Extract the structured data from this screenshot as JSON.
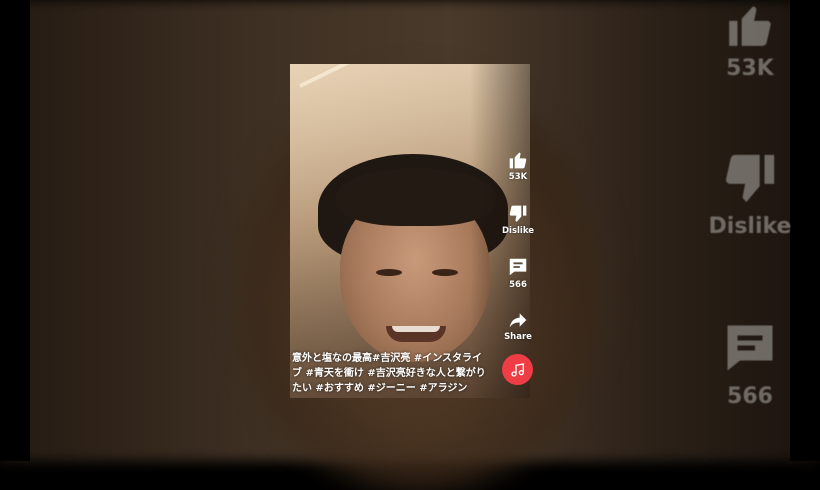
{
  "actions": {
    "like_count": "53K",
    "dislike_label": "Dislike",
    "comment_count": "566",
    "share_label": "Share"
  },
  "caption": "意外と塩なの最高#吉沢亮 #インスタライブ #青天を衝け #吉沢亮好きな人と繋がりたい #おすすめ #ジーニー #アラジン",
  "icons": {
    "like": "thumbs-up-icon",
    "dislike": "thumbs-down-icon",
    "comment": "comment-icon",
    "share": "share-arrow-icon",
    "music": "music-note-icon"
  },
  "colors": {
    "music_button": "#ee3d44",
    "action_text": "#ffffff"
  }
}
